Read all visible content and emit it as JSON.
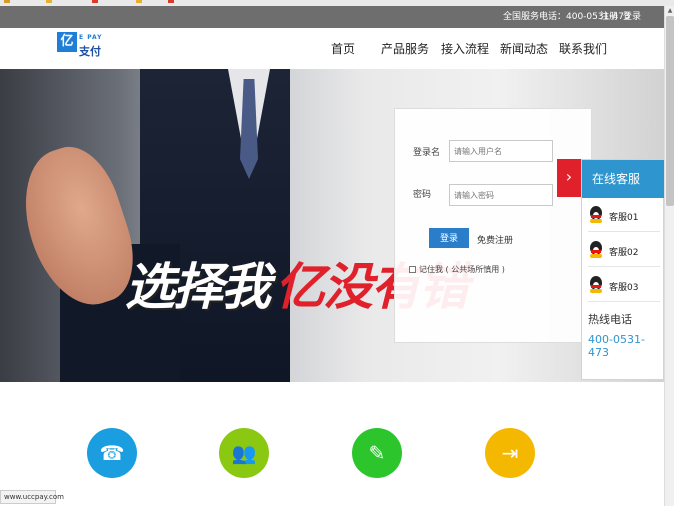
{
  "topbar": {
    "hotline": "全国服务电话：400-0531-473",
    "register": "注册",
    "login": "登录"
  },
  "logo": {
    "mark": "亿",
    "sub": "E PAY",
    "name": "支付"
  },
  "nav": [
    "首页",
    "产品服务",
    "接入流程",
    "新闻动态",
    "联系我们"
  ],
  "hero": {
    "slogan_white": "选择我",
    "slogan_red": "亿没有错"
  },
  "login_form": {
    "username_label": "登录名",
    "username_placeholder": "请输入用户名",
    "password_label": "密码",
    "password_placeholder": "请输入密码",
    "login_button": "登录",
    "register_link": "免费注册",
    "remember": "记住我 ( 公共场所慎用 )"
  },
  "customer_service": {
    "toggle": "›",
    "title": "在线客服",
    "agents": [
      "客服01",
      "客服02",
      "客服03"
    ],
    "hotline_label": "热线电话",
    "hotline_number": "400-0531-473"
  },
  "features": [
    {
      "icon": "phone-icon",
      "color": "#1a9ee0"
    },
    {
      "icon": "users-icon",
      "color": "#8bc812"
    },
    {
      "icon": "tools-icon",
      "color": "#2cc62c"
    },
    {
      "icon": "exit-icon",
      "color": "#f5b800"
    }
  ],
  "status_bar": {
    "url": "www.uccpay.com"
  }
}
